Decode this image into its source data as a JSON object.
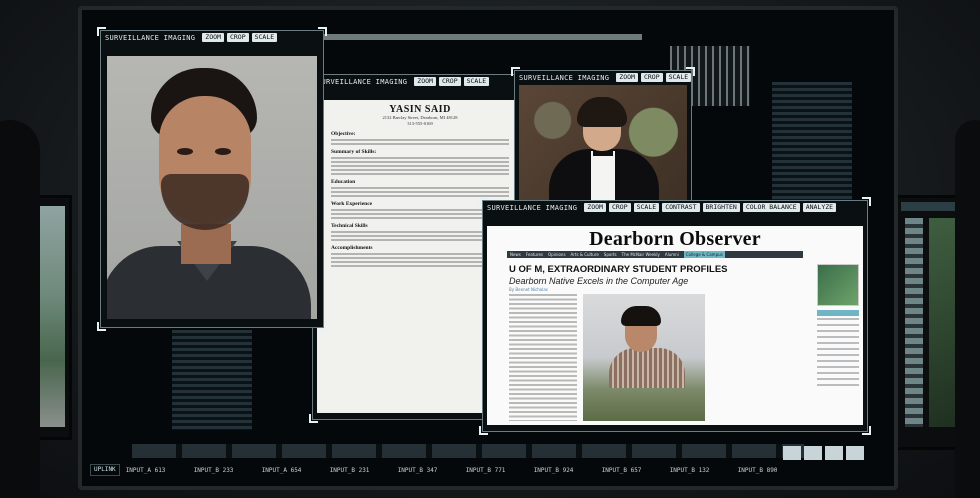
{
  "panels": {
    "portrait": {
      "title": "SURVEILLANCE IMAGING",
      "tools": [
        "ZOOM",
        "CROP",
        "SCALE"
      ]
    },
    "resume": {
      "title": "SURVEILLANCE IMAGING",
      "tools": [
        "ZOOM",
        "CROP",
        "SCALE"
      ],
      "doc": {
        "name": "YASIN SAID",
        "address": "2132 Barclay Street, Dearborn, MI 48128",
        "phone": "313-555-0169",
        "sections": [
          "Objective:",
          "Summary of Skills:",
          "Education",
          "Work Experience",
          "Technical Skills",
          "Accomplishments"
        ]
      }
    },
    "formal": {
      "title": "SURVEILLANCE IMAGING",
      "tools": [
        "ZOOM",
        "CROP",
        "SCALE"
      ]
    },
    "news": {
      "title": "SURVEILLANCE IMAGING",
      "tools": [
        "ZOOM",
        "CROP",
        "SCALE",
        "CONTRAST",
        "BRIGHTEN",
        "COLOR BALANCE",
        "ANALYZE"
      ],
      "page": {
        "masthead": "Dearborn Observer",
        "nav": [
          "News",
          "Features",
          "Opinions",
          "Arts & Culture",
          "Sports",
          "The McNair Weekly",
          "Alumni",
          "College & Campus"
        ],
        "headline": "U OF M, EXTRAORDINARY STUDENT PROFILES",
        "subhead": "Dearborn Native Excels in the Computer Age",
        "byline": "By Bennet Nicholas"
      }
    }
  },
  "status_bar": {
    "uplink": "UPLINK",
    "inputs": [
      "INPUT_A 613",
      "INPUT_B 233",
      "INPUT_A 654",
      "INPUT_B 231",
      "INPUT_B 347",
      "INPUT_B 771",
      "INPUT_B 924",
      "INPUT_B 657",
      "INPUT_B 132",
      "INPUT_B 890"
    ]
  }
}
